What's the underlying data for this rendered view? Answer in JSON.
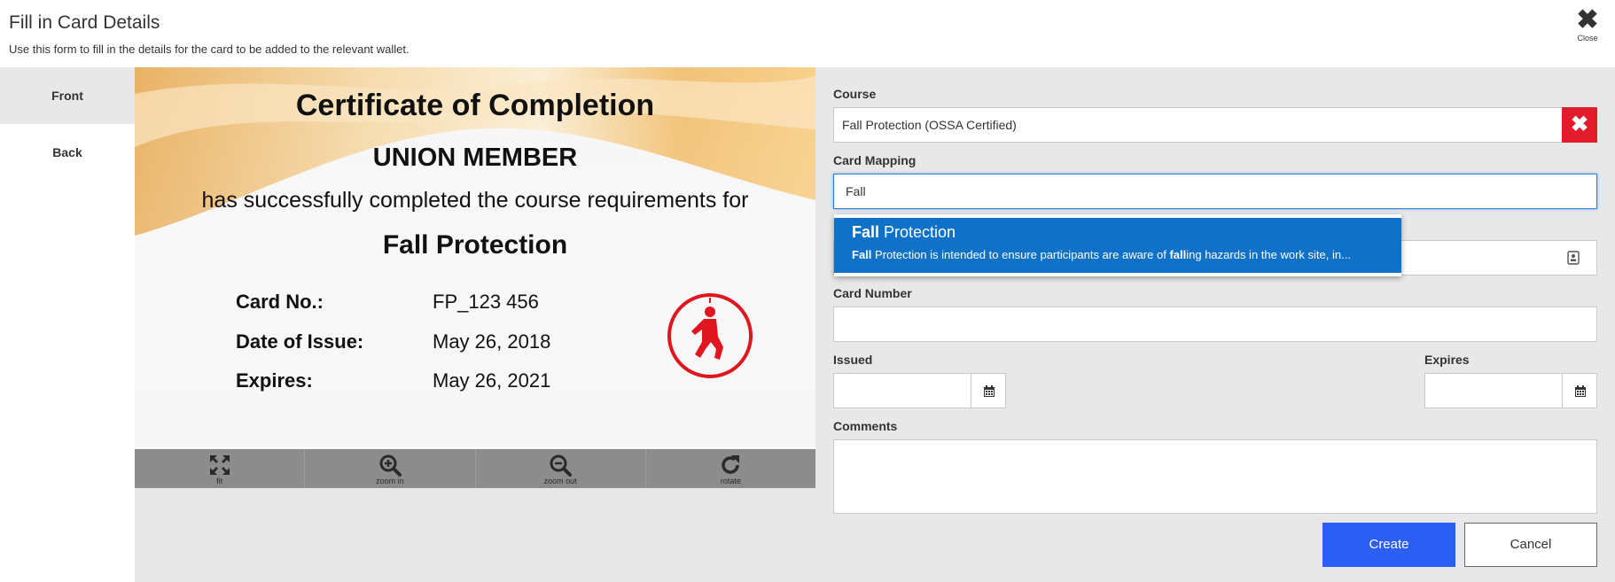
{
  "header": {
    "title": "Fill in Card Details",
    "subtitle": "Use this form to fill in the details for the card to be added to the relevant wallet.",
    "close_label": "Close"
  },
  "side_tabs": [
    {
      "label": "Front",
      "active": true
    },
    {
      "label": "Back",
      "active": false
    }
  ],
  "card_preview": {
    "title": "Certificate of Completion",
    "member": "UNION MEMBER",
    "description": "has successfully completed the course requirements for",
    "course": "Fall Protection",
    "rows": [
      {
        "key": "Card No.:",
        "value": "FP_123 456"
      },
      {
        "key": "Date of Issue:",
        "value": "May 26, 2018"
      },
      {
        "key": "Expires:",
        "value": "May 26, 2021"
      }
    ]
  },
  "toolbar": {
    "fit": "fit",
    "zoom_in": "zoom in",
    "zoom_out": "zoom out",
    "rotate": "rotate"
  },
  "form": {
    "course_label": "Course",
    "course_value": "Fall Protection (OSSA Certified)",
    "card_mapping_label": "Card Mapping",
    "card_mapping_value": "Fall",
    "card_number_label": "Card Number",
    "card_number_value": "",
    "issued_label": "Issued",
    "issued_value": "",
    "expires_label": "Expires",
    "expires_value": "",
    "comments_label": "Comments",
    "comments_value": ""
  },
  "suggestion": {
    "title_match": "Fall",
    "title_rest": " Protection",
    "desc_match1": "Fall",
    "desc_mid": " Protection is intended to ensure participants are aware of ",
    "desc_match2": "fall",
    "desc_rest": "ing hazards in the work site, in..."
  },
  "buttons": {
    "create": "Create",
    "cancel": "Cancel"
  },
  "colors": {
    "primary_button": "#2d5ef5",
    "suggestion_highlight": "#0f71c8",
    "clear_button": "#e21d2b",
    "badge_red": "#e0161e"
  }
}
